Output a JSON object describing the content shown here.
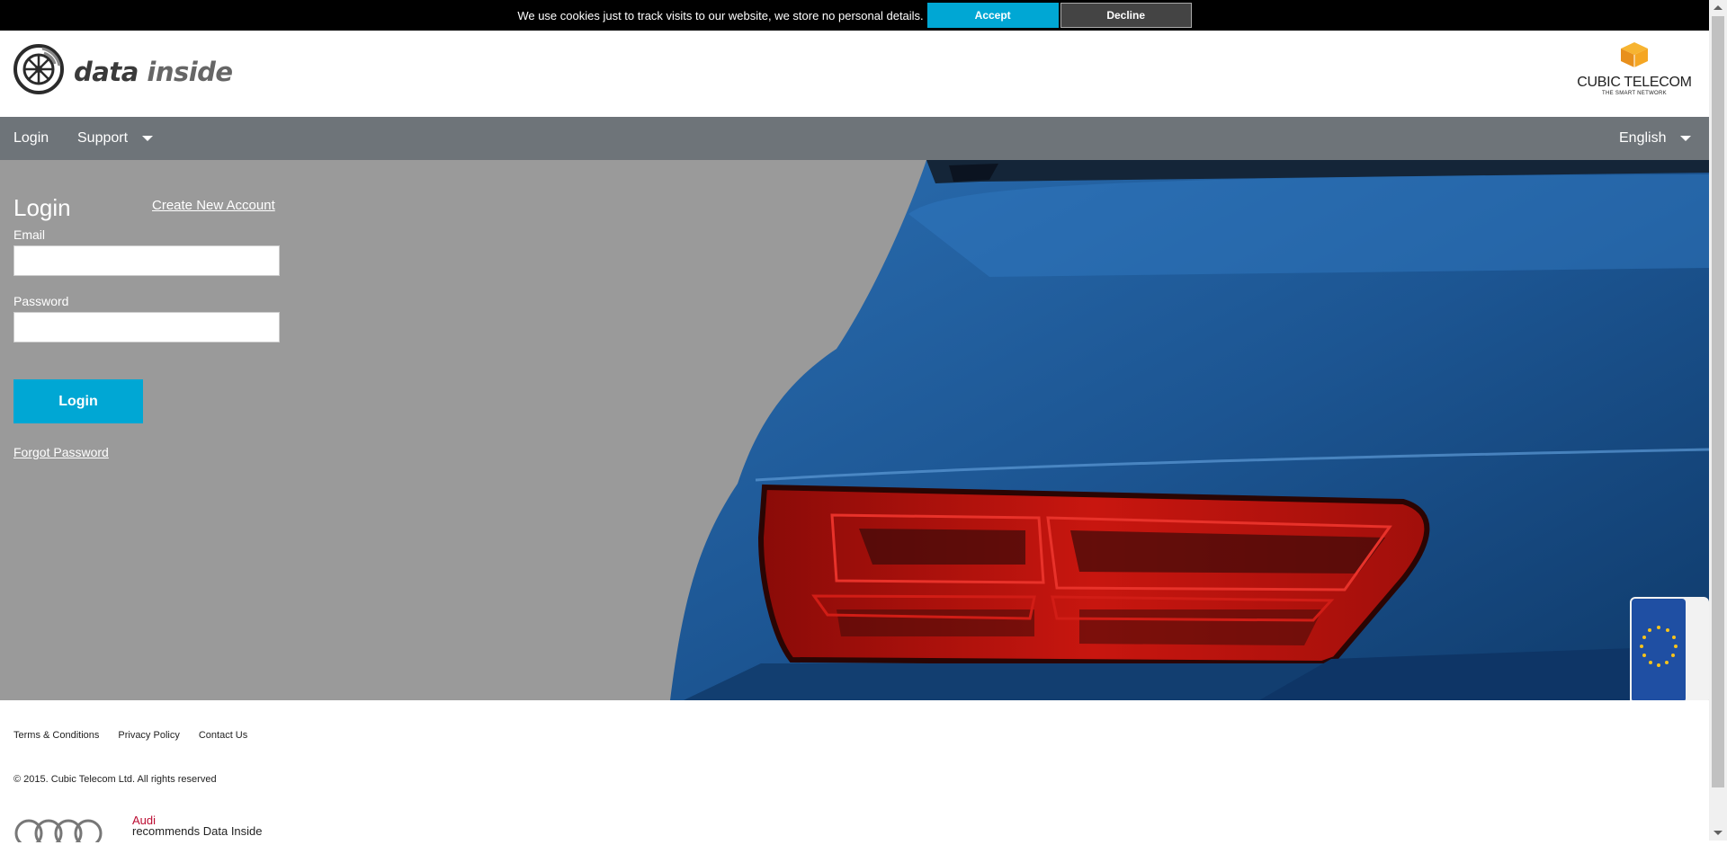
{
  "cookie": {
    "message": "We use cookies just to track visits to our website, we store no personal details.",
    "accept_label": "Accept",
    "decline_label": "Decline"
  },
  "header": {
    "brand_word1": "data",
    "brand_word2": "inside",
    "partner_name": "CUBIC TELECOM",
    "partner_tagline": "THE SMART NETWORK"
  },
  "nav": {
    "login_label": "Login",
    "support_label": "Support",
    "language_label": "English"
  },
  "login": {
    "title": "Login",
    "create_account_label": "Create New Account",
    "email_label": "Email",
    "email_value": "",
    "password_label": "Password",
    "password_value": "",
    "submit_label": "Login",
    "forgot_label": "Forgot Password"
  },
  "footer": {
    "links": [
      "Terms & Conditions",
      "Privacy Policy",
      "Contact Us"
    ],
    "copyright": "© 2015. Cubic Telecom Ltd. All rights reserved",
    "audi_brand": "Audi",
    "audi_recommend": "recommends Data Inside"
  },
  "colors": {
    "accent": "#00a7d4",
    "nav_bg": "#6e7479",
    "hero_bg": "#9a9a9a",
    "car_blue": "#1f5e9c",
    "taillight_red": "#c0140f",
    "audi_red": "#bb0a30"
  },
  "icons": {
    "brand_logo": "wheel-logo-icon",
    "partner_logo": "cube-icon",
    "support_caret": "chevron-down-icon",
    "language_caret": "chevron-down-icon",
    "audi_logo": "audi-rings-icon"
  }
}
